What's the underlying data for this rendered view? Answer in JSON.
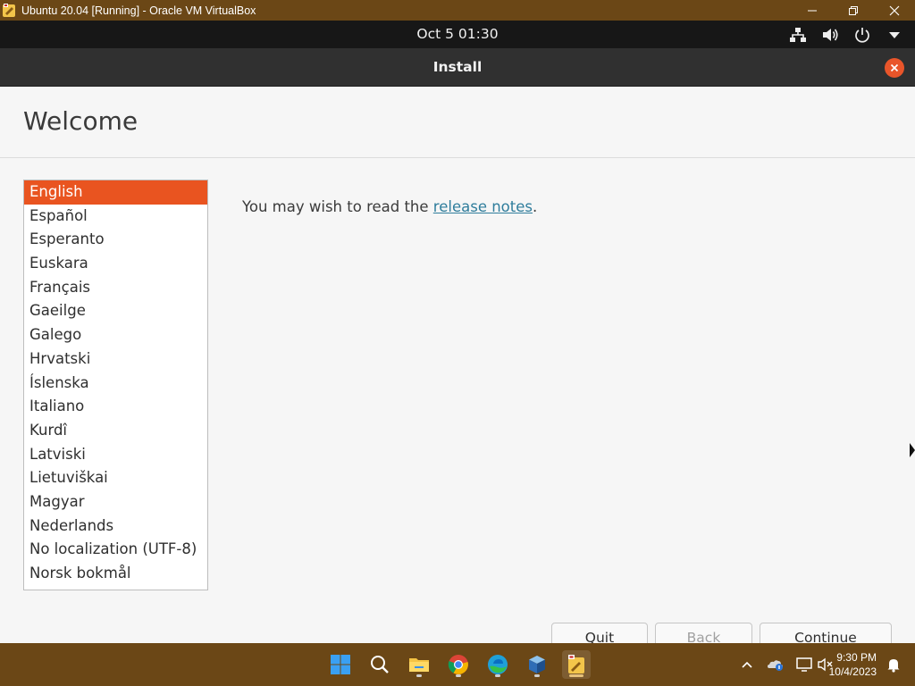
{
  "host_window": {
    "title": "Ubuntu 20.04 [Running] - Oracle VM VirtualBox",
    "controls": {
      "minimize": "—",
      "maximize": "❐",
      "close": "✕"
    }
  },
  "guest_topbar": {
    "clock": "Oct 5  01:30"
  },
  "installer": {
    "title": "Install",
    "page_title": "Welcome",
    "languages": [
      "English",
      "Español",
      "Esperanto",
      "Euskara",
      "Français",
      "Gaeilge",
      "Galego",
      "Hrvatski",
      "Íslenska",
      "Italiano",
      "Kurdî",
      "Latviski",
      "Lietuviškai",
      "Magyar",
      "Nederlands",
      "No localization (UTF-8)",
      "Norsk bokmål"
    ],
    "selected_language": "English",
    "release_text_prefix": "You may wish to read the ",
    "release_link": "release notes",
    "release_text_suffix": ".",
    "buttons": {
      "quit": "Quit",
      "back": "Back",
      "continue": "Continue"
    }
  },
  "taskbar": {
    "apps": [
      "start-icon",
      "search-icon",
      "file-explorer-icon",
      "chrome-icon",
      "edge-icon",
      "virtualbox-icon",
      "virtualbox-vm-icon"
    ],
    "clock_time": "9:30 PM",
    "clock_date": "10/4/2023"
  },
  "colors": {
    "accent": "#e95420",
    "host_frame": "#6b4716",
    "link": "#2f7d9c"
  }
}
